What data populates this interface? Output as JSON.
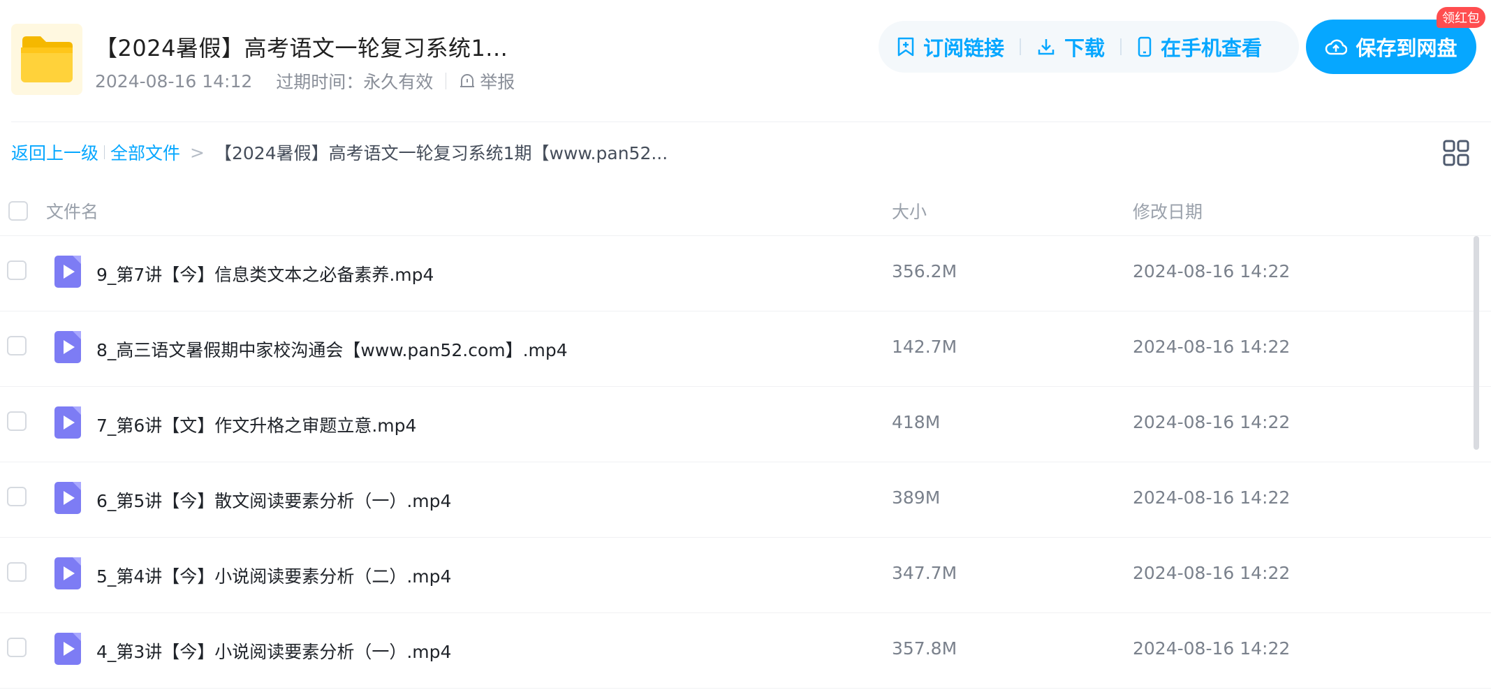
{
  "header": {
    "title": "【2024暑假】高考语文一轮复习系统1...",
    "date": "2024-08-16 14:12",
    "expire_label": "过期时间：永久有效",
    "report_label": "举报",
    "icon": "folder-icon"
  },
  "actions": {
    "subscribe_label": "订阅链接",
    "download_label": "下载",
    "phone_label": "在手机查看",
    "save_label": "保存到网盘",
    "badge_label": "领红包",
    "accent_color": "#06a7ff"
  },
  "breadcrumb": {
    "back_label": "返回上一级",
    "all_files_label": "全部文件",
    "separator": ">",
    "current": "【2024暑假】高考语文一轮复习系统1期【www.pan52..."
  },
  "table": {
    "columns": {
      "name": "文件名",
      "size": "大小",
      "date": "修改日期"
    },
    "rows": [
      {
        "name": "9_第7讲【今】信息类文本之必备素养.mp4",
        "size": "356.2M",
        "date": "2024-08-16 14:22",
        "icon": "video-file-icon"
      },
      {
        "name": "8_高三语文暑假期中家校沟通会【www.pan52.com】.mp4",
        "size": "142.7M",
        "date": "2024-08-16 14:22",
        "icon": "video-file-icon"
      },
      {
        "name": "7_第6讲【文】作文升格之审题立意.mp4",
        "size": "418M",
        "date": "2024-08-16 14:22",
        "icon": "video-file-icon"
      },
      {
        "name": "6_第5讲【今】散文阅读要素分析（一）.mp4",
        "size": "389M",
        "date": "2024-08-16 14:22",
        "icon": "video-file-icon"
      },
      {
        "name": "5_第4讲【今】小说阅读要素分析（二）.mp4",
        "size": "347.7M",
        "date": "2024-08-16 14:22",
        "icon": "video-file-icon"
      },
      {
        "name": "4_第3讲【今】小说阅读要素分析（一）.mp4",
        "size": "357.8M",
        "date": "2024-08-16 14:22",
        "icon": "video-file-icon"
      }
    ]
  }
}
